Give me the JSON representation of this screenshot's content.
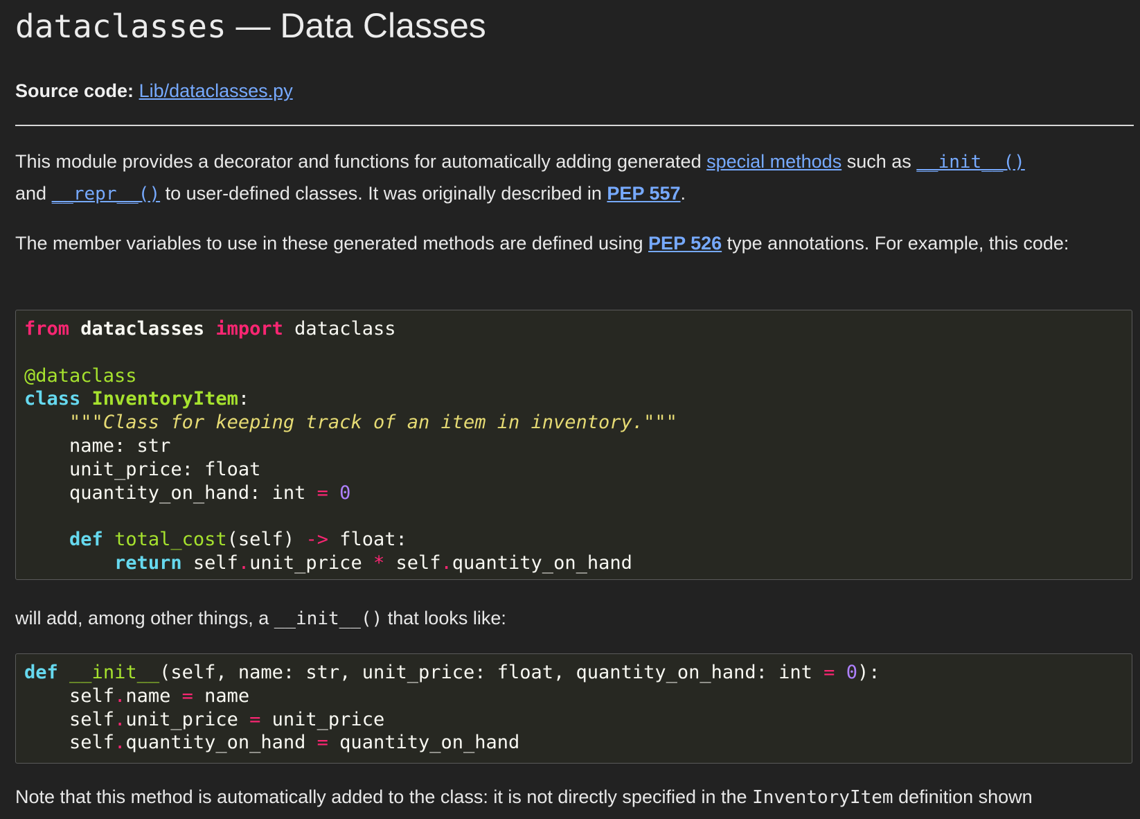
{
  "title": {
    "module": "dataclasses",
    "text": " — Data Classes"
  },
  "source": {
    "label": "Source code:",
    "link": "Lib/dataclasses.py"
  },
  "intro": {
    "t1": "This module provides a decorator and functions for automatically adding generated ",
    "link_special": "special methods",
    "t2": " such as ",
    "link_init": "__init__()",
    "t3": " and ",
    "link_repr": "__repr__()",
    "t4": " to user-defined classes. It was originally described in ",
    "link_pep557": "PEP 557",
    "t5": "."
  },
  "members": {
    "t1": "The member variables to use in these generated methods are defined using ",
    "link_pep526": "PEP 526",
    "t2": " type annotations. For example, this code:"
  },
  "code1": {
    "l1": {
      "from": "from",
      "mod": "dataclasses",
      "import": "import",
      "name": " dataclass"
    },
    "l3": "@dataclass",
    "l4": {
      "class": "class",
      "name": "InventoryItem",
      "colon": ":"
    },
    "l5": {
      "indent": "    ",
      "q1": "\"\"\"",
      "doc": "Class for keeping track of an item in inventory.",
      "q2": "\"\"\""
    },
    "l6": "    name: str",
    "l7": "    unit_price: float",
    "l8": {
      "a": "    quantity_on_hand: int ",
      "eq": "=",
      "sp": " ",
      "num": "0"
    },
    "l10": {
      "indent": "    ",
      "def": "def",
      "sp": " ",
      "fn": "total_cost",
      "args": "(self) ",
      "arrow": "->",
      "ret": " float:"
    },
    "l11": {
      "indent": "        ",
      "return": "return",
      "a": " self",
      "dot1": ".",
      "b": "unit_price ",
      "mul": "*",
      "c": " self",
      "dot2": ".",
      "d": "quantity_on_hand"
    }
  },
  "will_add": {
    "t1": "will add, among other things, a ",
    "mono": "__init__()",
    "t2": " that looks like:"
  },
  "code2": {
    "l1": {
      "def": "def",
      "sp": " ",
      "fn": "__init__",
      "args": "(self, name: str, unit_price: float, quantity_on_hand: int ",
      "eq": "=",
      "sp2": " ",
      "num": "0",
      "end": "):"
    },
    "l2": {
      "a": "    self",
      "dot": ".",
      "b": "name ",
      "eq": "=",
      "c": " name"
    },
    "l3": {
      "a": "    self",
      "dot": ".",
      "b": "unit_price ",
      "eq": "=",
      "c": " unit_price"
    },
    "l4": {
      "a": "    self",
      "dot": ".",
      "b": "quantity_on_hand ",
      "eq": "=",
      "c": " quantity_on_hand"
    }
  },
  "note": {
    "t1": "Note that this method is automatically added to the class: it is not directly specified in the ",
    "mono": "InventoryItem",
    "t2": " definition shown"
  }
}
